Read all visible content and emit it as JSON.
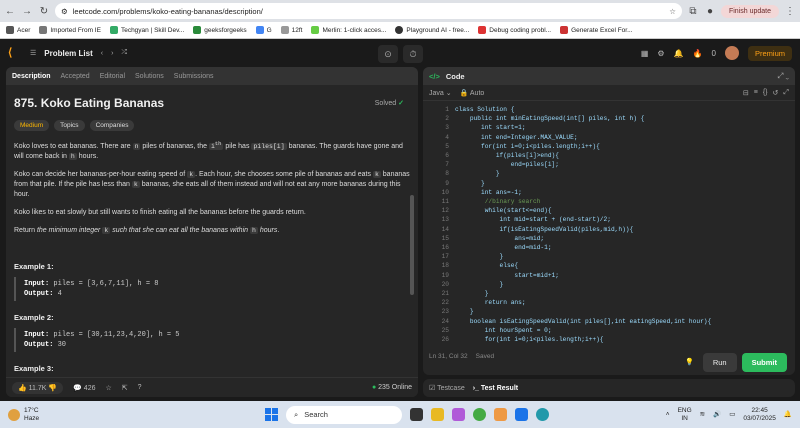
{
  "browser": {
    "url": "leetcode.com/problems/koko-eating-bananas/description/",
    "finish_update": "Finish update",
    "bookmarks": [
      "Acer",
      "Imported From IE",
      "Techgyan | Skill Dev...",
      "geeksforgeeks",
      "G",
      "12ft",
      "Merlin: 1-click acces...",
      "Playground AI - free...",
      "Debug coding probl...",
      "Generate Excel For..."
    ]
  },
  "lc": {
    "problem_list": "Problem List",
    "fire_count": "0",
    "premium": "Premium"
  },
  "left": {
    "tabs": [
      "Description",
      "Accepted",
      "Editorial",
      "Solutions",
      "Submissions"
    ],
    "title": "875. Koko Eating Bananas",
    "solved": "Solved",
    "tags": [
      "Medium",
      "Topics",
      "Companies"
    ],
    "examples": [
      {
        "title": "Example 1:",
        "input": "piles = [3,6,7,11], h = 8",
        "output": "4"
      },
      {
        "title": "Example 2:",
        "input": "piles = [30,11,23,4,20], h = 5",
        "output": "30"
      },
      {
        "title": "Example 3:"
      }
    ],
    "likes": "11.7K",
    "comments": "426",
    "online": "235 Online"
  },
  "code": {
    "header": "Code",
    "language": "Java",
    "mode": "Auto",
    "status": "Ln 31, Col 32",
    "saved": "Saved",
    "run": "Run",
    "submit": "Submit",
    "testcase": "Testcase",
    "test_result": "Test Result",
    "lines": [
      "class Solution {",
      "    public int minEatingSpeed(int[] piles, int h) {",
      "       int start=1;",
      "       int end=Integer.MAX_VALUE;",
      "       for(int i=0;i<piles.length;i++){",
      "           if(piles[i]>end){",
      "               end=piles[i];",
      "           }",
      "       }",
      "       int ans=-1;",
      "        //binary search",
      "        while(start<=end){",
      "            int mid=start + (end-start)/2;",
      "            if(isEatingSpeedValid(piles,mid,h)){",
      "                ans=mid;",
      "                end=mid-1;",
      "            }",
      "            else{",
      "                start=mid+1;",
      "            }",
      "        }",
      "        return ans;",
      "    }",
      "    boolean isEatingSpeedValid(int piles[],int eatingSpeed,int hour){",
      "        int hourSpent = 0;",
      "        for(int i=0;i<piles.length;i++){"
    ]
  },
  "taskbar": {
    "temp": "17°C",
    "weather": "Haze",
    "search": "Search",
    "lang": "ENG",
    "region": "IN",
    "time": "22:45",
    "date": "03/07/2025"
  }
}
